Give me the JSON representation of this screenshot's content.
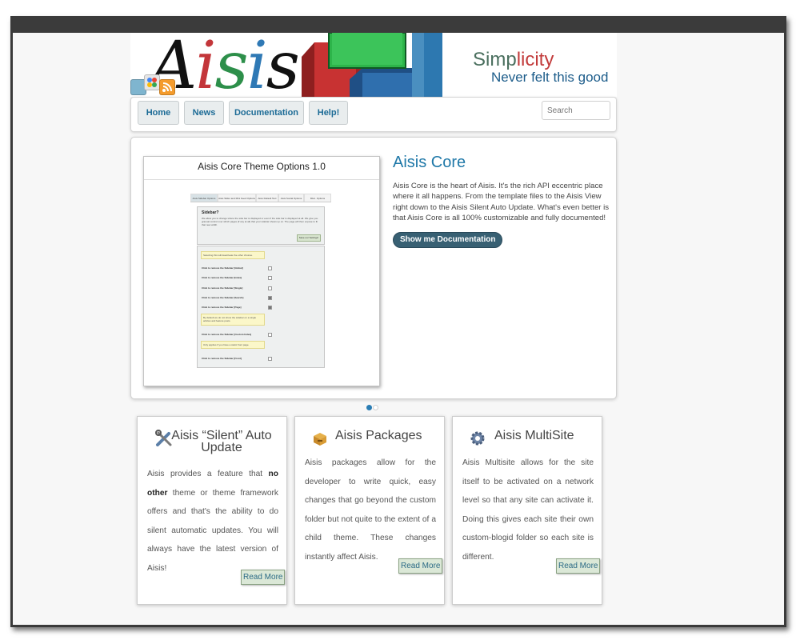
{
  "header": {
    "logo_letters": [
      "A",
      "i",
      "s",
      "i",
      "s"
    ],
    "slogan_prefix": "Simp",
    "slogan_highlight": "licity",
    "slogan_sub": "Never felt this good",
    "social_icons": [
      "twitter-icon",
      "google-icon",
      "rss-icon"
    ]
  },
  "nav": {
    "items": [
      {
        "label": "Home"
      },
      {
        "label": "News"
      },
      {
        "label": "Documentation"
      },
      {
        "label": "Help!"
      }
    ],
    "search_placeholder": "Search"
  },
  "slider": {
    "slide": {
      "title": "Aisis Core",
      "description": "Aisis Core is the heart of Aisis. It's the rich API eccentric place where it all happens. From the template files to the Aisis View right down to the Aisis Silent Auto Update. What's even better is that Aisis Core is all 100% customizable and fully documented!",
      "button": "Show me Documentation"
    },
    "screenshot": {
      "title": "Aisis Core Theme Options 1.0",
      "tabs": [
        "Aisis Sidebar Options",
        "Aisis Slider and Mini Feed Options",
        "Aisis Default Text",
        "Aisis Social Options",
        "Misc. Options"
      ],
      "panel_heading": "Sidebar?",
      "panel_text": "We allow you to change where the side bar is displayed or even if the side bar is displayed at all. We give you granual control over which pages (if any at all) that your sidebar shows up on. The page will then expose to fit that new width.",
      "panel_button": "Save our Settings!",
      "note_top": "Selecting this will deactivate the other choices.",
      "rows": [
        "Click to remove the Sidebar [Global]",
        "Click to remove the Sidebar [Index]",
        "Click to remove the Sidebar [Single]",
        "Click to remove the Sidebar [Search]",
        "Click to remove the Sidebar [Page]",
        "Click to remove the Sidebar [Custom Index]",
        "Click to remove the Sidebar [Front]"
      ],
      "note_mid": "By default we do not show the sidebar on a single articles and feature posts.",
      "note_low": "Only applies if you have a static front page."
    },
    "pager": {
      "count": 2,
      "active": 1
    }
  },
  "cards": [
    {
      "icon": "tools-icon",
      "title_line1": "Aisis “Silent” Auto",
      "title_line2": "Update",
      "text_a": "Aisis provides a feature that ",
      "text_b": "no other",
      "text_c": " theme or theme framework offers and that's the ability to do silent automatic updates. You will always have the latest version of Aisis!",
      "button": "Read More"
    },
    {
      "icon": "package-icon",
      "title_line1": "Aisis Packages",
      "text_a": "Aisis packages allow for the developer to write quick, easy changes that go beyond the custom folder but not quite to the extent of a child theme. These changes instantly affect Aisis.",
      "button": "Read More"
    },
    {
      "icon": "gear-icon",
      "title_line1": "Aisis MultiSite",
      "text_a": "Aisis Multisite allows for the site itself to be activated on a network level so that any site can activate it. Doing this gives each site their own custom-blogid folder so each site is different.",
      "button": "Read More"
    }
  ],
  "colors": {
    "accent": "#1f78a8",
    "topbar": "#3b3b3b",
    "button_dark": "#386073"
  }
}
